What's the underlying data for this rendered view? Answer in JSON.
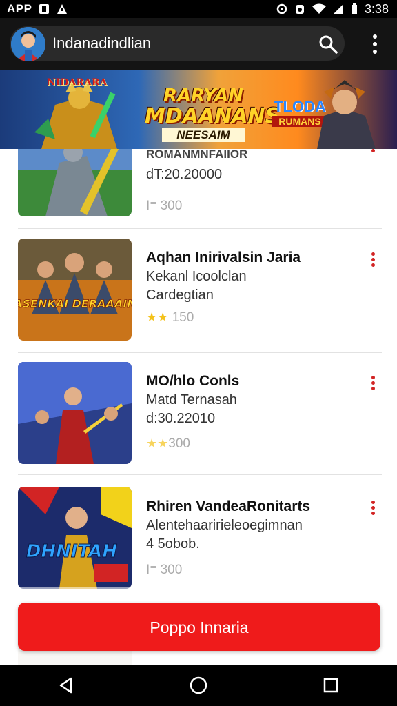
{
  "status_bar": {
    "app_label": "APP",
    "time": "3:38"
  },
  "header": {
    "title": "Indanadindlian",
    "search_icon": "search-icon",
    "menu_icon": "more-vert-icon"
  },
  "banner": {
    "sign_left": "NIDARARA",
    "main_line1": "RARYAN",
    "main_line2": "MDAANANS",
    "main_sub": "NEESAIM",
    "right_line1": "TLODA",
    "right_line2": "RUMANS"
  },
  "items": [
    {
      "title": "ROMANMNFAIIOR",
      "line1": "dT:20.20000",
      "line2": "",
      "rating": "300",
      "thumb_text": ""
    },
    {
      "title": "Aqhan Inirivalsin Jaria",
      "line1": "Kekanl Icoolclan",
      "line2": "Cardegtian",
      "rating": "150",
      "thumb_text": "DASENKAI DERAAAINS"
    },
    {
      "title": "MO/hlo Conls",
      "line1": "Matd Ternasah",
      "line2": "d:30.22010",
      "rating": "300",
      "thumb_text": ""
    },
    {
      "title": "Rhiren VandeaRonitarts",
      "line1": "Alentehaaririeleoegimnan",
      "line2": "4 5obob.",
      "rating": "300",
      "thumb_text": "DHNITAH"
    }
  ],
  "cta": {
    "label": "Poppo Innaria"
  },
  "colors": {
    "accent": "#ef1b1b",
    "appbar": "#141414",
    "star": "#f4c21a"
  }
}
